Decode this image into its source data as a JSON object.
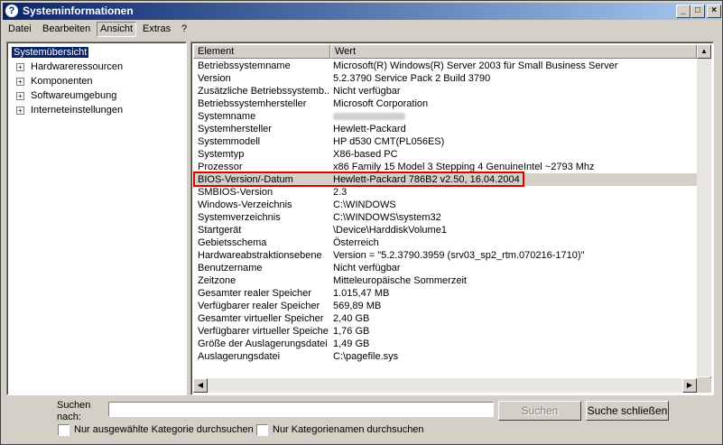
{
  "window": {
    "title": "Systeminformationen",
    "app_icon_glyph": "?",
    "controls": {
      "minimize": "_",
      "maximize": "□",
      "close": "×"
    }
  },
  "menu": [
    {
      "label": "Datei"
    },
    {
      "label": "Bearbeiten"
    },
    {
      "label": "Ansicht"
    },
    {
      "label": "Extras"
    },
    {
      "label": "?"
    }
  ],
  "tree": {
    "root": "Systemübersicht",
    "children": [
      {
        "label": "Hardwareressourcen"
      },
      {
        "label": "Komponenten"
      },
      {
        "label": "Softwareumgebung"
      },
      {
        "label": "Interneteinstellungen"
      }
    ],
    "expander_glyph": "+"
  },
  "table": {
    "headers": [
      "Element",
      "Wert"
    ],
    "rows": [
      [
        "Betriebssystemname",
        "Microsoft(R) Windows(R) Server 2003 für Small Business Server"
      ],
      [
        "Version",
        "5.2.3790 Service Pack 2 Build 3790"
      ],
      [
        "Zusätzliche Betriebssystemb...",
        "Nicht verfügbar"
      ],
      [
        "Betriebssystemhersteller",
        "Microsoft Corporation"
      ],
      [
        "Systemname",
        ""
      ],
      [
        "Systemhersteller",
        "Hewlett-Packard"
      ],
      [
        "Systemmodell",
        "HP d530 CMT(PL056ES)"
      ],
      [
        "Systemtyp",
        "X86-based PC"
      ],
      [
        "Prozessor",
        "x86 Family 15 Model 3 Stepping 4 GenuineIntel ~2793 Mhz"
      ],
      [
        "BIOS-Version/-Datum",
        "Hewlett-Packard 786B2 v2.50, 16.04.2004"
      ],
      [
        "SMBIOS-Version",
        "2.3"
      ],
      [
        "Windows-Verzeichnis",
        "C:\\WINDOWS"
      ],
      [
        "Systemverzeichnis",
        "C:\\WINDOWS\\system32"
      ],
      [
        "Startgerät",
        "\\Device\\HarddiskVolume1"
      ],
      [
        "Gebietsschema",
        "Österreich"
      ],
      [
        "Hardwareabstraktionsebene",
        "Version = \"5.2.3790.3959 (srv03_sp2_rtm.070216-1710)\""
      ],
      [
        "Benutzername",
        "Nicht verfügbar"
      ],
      [
        "Zeitzone",
        "Mitteleuropäische Sommerzeit"
      ],
      [
        "Gesamter realer Speicher",
        "1.015,47 MB"
      ],
      [
        "Verfügbarer realer Speicher",
        "569,89 MB"
      ],
      [
        "Gesamter virtueller Speicher",
        "2,40 GB"
      ],
      [
        "Verfügbarer virtueller Speicher",
        "1,76 GB"
      ],
      [
        "Größe der Auslagerungsdatei",
        "1,49 GB"
      ],
      [
        "Auslagerungsdatei",
        "C:\\pagefile.sys"
      ]
    ]
  },
  "scroll": {
    "up": "▲",
    "down": "▼",
    "left": "◀",
    "right": "▶"
  },
  "search": {
    "label_line1": "Suchen",
    "label_line2": "nach:",
    "value": "",
    "search_button": "Suchen",
    "close_button": "Suche schließen",
    "checkbox1_label": "Nur ausgewählte Kategorie durchsuchen",
    "checkbox2_label": "Nur Kategorienamen durchsuchen"
  },
  "colors": {
    "highlight_box": "#e00000",
    "title_start": "#0a246a",
    "title_end": "#a6caf0",
    "selection": "#0a246a"
  }
}
